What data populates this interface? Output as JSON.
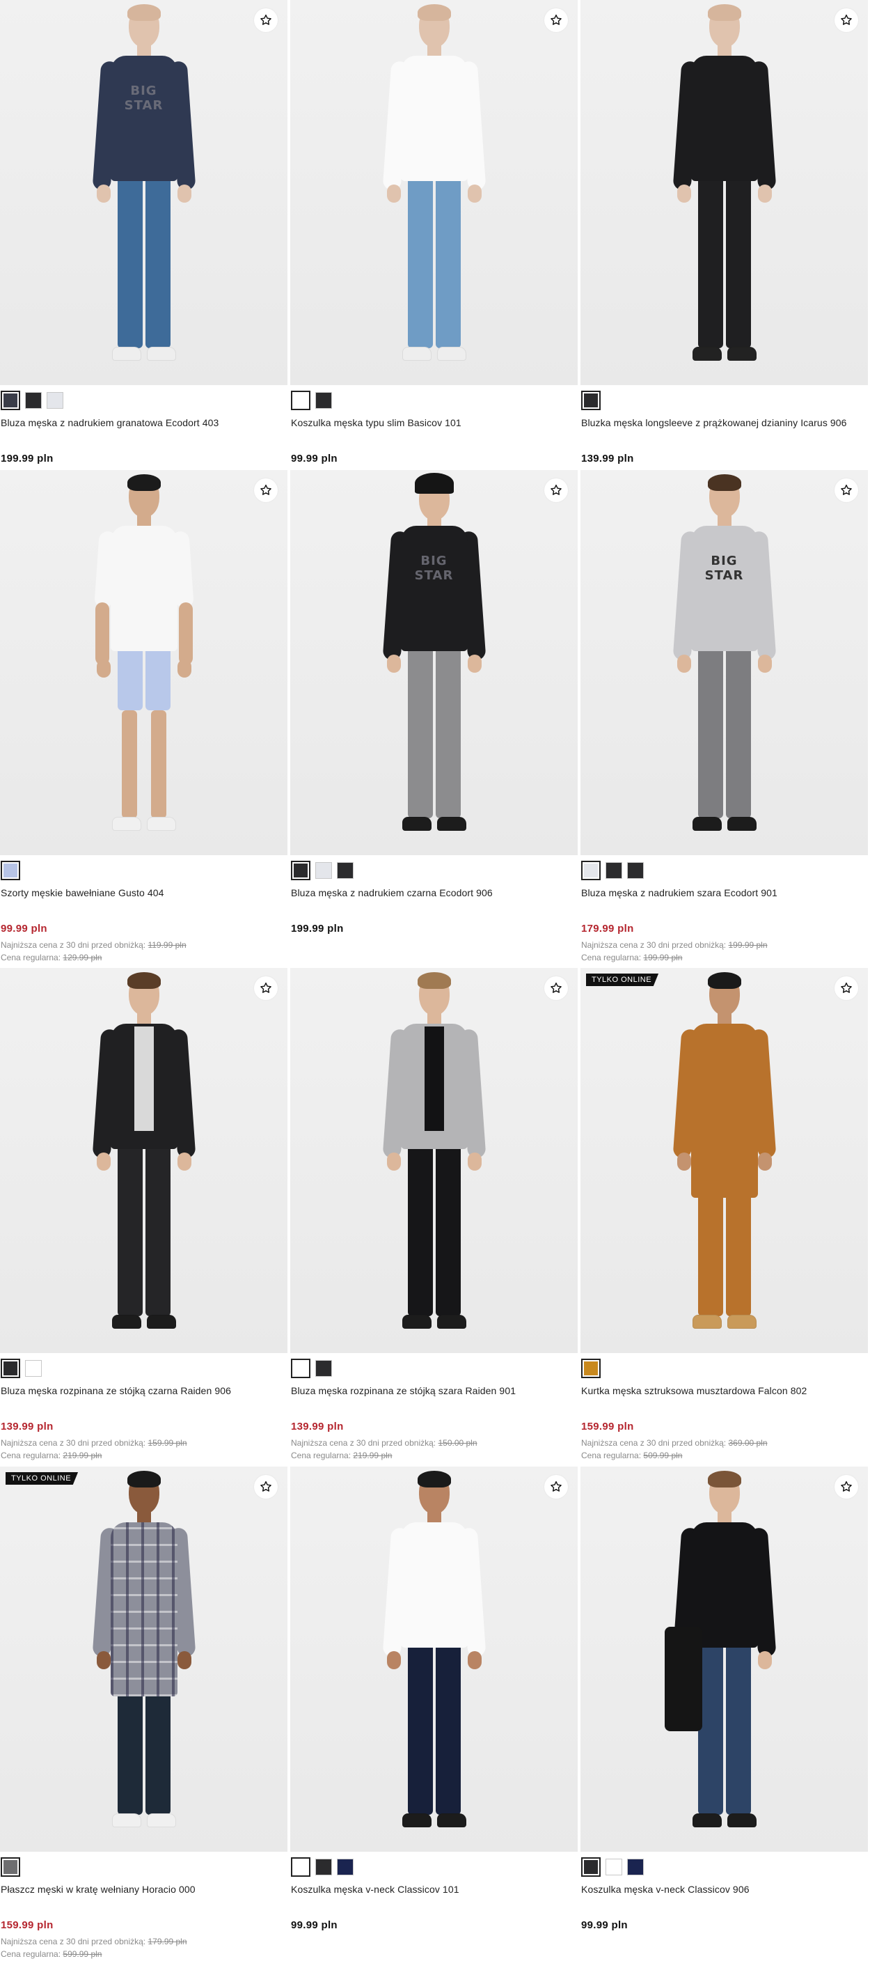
{
  "labels": {
    "lowest_prefix": "Najniższa cena z 30 dni przed obniżką:",
    "regular_prefix": "Cena regularna:"
  },
  "colors": {
    "sale_price": "#b5262f",
    "text": "#111111",
    "muted": "#8a8a8a"
  },
  "products": [
    {
      "name": "Bluza męska z nadrukiem granatowa Ecodort 403",
      "price": "199.99 pln",
      "sale": false,
      "swatches": [
        "#3a3d48",
        "#2b2b2d",
        "#e4e6eb"
      ],
      "badge": "",
      "outfit": {
        "top": "#2f3952",
        "topPrint": "BIG STAR",
        "bottom": "#3e6b99",
        "shoes": "#eeeeee",
        "skin": "#e0c3ae",
        "hair": "#d6b59c"
      }
    },
    {
      "name": "Koszulka męska typu slim Basicov 101",
      "price": "99.99 pln",
      "sale": false,
      "swatches": [
        "#ffffff",
        "#2b2b2d"
      ],
      "badge": "",
      "outfit": {
        "top": "#fafafa",
        "topPrint": "",
        "bottom": "#6f9cc5",
        "shoes": "#eeeeee",
        "skin": "#e0c3ae",
        "hair": "#d6b59c"
      }
    },
    {
      "name": "Bluzka męska longsleeve z prążkowanej dzianiny Icarus 906",
      "price": "139.99 pln",
      "sale": false,
      "swatches": [
        "#2b2b2d"
      ],
      "badge": "",
      "outfit": {
        "top": "#1c1c1e",
        "topPrint": "",
        "bottom": "#1f1f21",
        "shoes": "#222222",
        "skin": "#e0c3ae",
        "hair": "#d6b59c"
      }
    },
    {
      "name": "Szorty męskie bawełniane Gusto 404",
      "price": "99.99 pln",
      "sale": true,
      "lowest": "119.99 pln",
      "regular": "129.99 pln",
      "swatches": [
        "#b7c4e6"
      ],
      "badge": "",
      "outfit": {
        "top": "#f7f7f7",
        "topPrint": "",
        "bottom": "#b8c8ea",
        "shoes": "#f0f0f0",
        "skin": "#d3ab8c",
        "hair": "#1b1b1b",
        "shorts": true
      }
    },
    {
      "name": "Bluza męska z nadrukiem czarna Ecodort 906",
      "price": "199.99 pln",
      "sale": false,
      "swatches": [
        "#2b2b2d",
        "#e4e6eb",
        "#2b2b2d"
      ],
      "badge": "",
      "outfit": {
        "top": "#1d1d1f",
        "topPrint": "BIG STAR",
        "bottom": "#8c8c8e",
        "shoes": "#1c1c1c",
        "skin": "#dcb79b",
        "hair": "#1a1a1a",
        "cap": true
      }
    },
    {
      "name": "Bluza męska z nadrukiem szara Ecodort 901",
      "price": "179.99 pln",
      "sale": true,
      "lowest": "199.99 pln",
      "regular": "199.99 pln",
      "swatches": [
        "#e4e6eb",
        "#2b2b2d",
        "#2b2b2d"
      ],
      "badge": "",
      "outfit": {
        "top": "#c8c8cb",
        "topPrint": "BIG STAR",
        "bottom": "#7d7d80",
        "shoes": "#1c1c1c",
        "skin": "#dcb79b",
        "hair": "#4a3322"
      }
    },
    {
      "name": "Bluza męska rozpinana ze stójką czarna Raiden 906",
      "price": "139.99 pln",
      "sale": true,
      "lowest": "159.99 pln",
      "regular": "219.99 pln",
      "swatches": [
        "#2b2b2d",
        "#ffffff"
      ],
      "badge": "",
      "outfit": {
        "top": "#202022",
        "topPrint": "",
        "bottom": "#252527",
        "shoes": "#1c1c1c",
        "skin": "#dcb79b",
        "hair": "#5a3d27",
        "inner": "#d9d9d9"
      }
    },
    {
      "name": "Bluza męska rozpinana ze stójką szara Raiden 901",
      "price": "139.99 pln",
      "sale": true,
      "lowest": "150.00 pln",
      "regular": "219.99 pln",
      "swatches": [
        "#ffffff",
        "#2b2b2d"
      ],
      "badge": "",
      "outfit": {
        "top": "#b4b4b6",
        "topPrint": "",
        "bottom": "#161618",
        "shoes": "#1c1c1c",
        "skin": "#dcb79b",
        "hair": "#a07a52",
        "inner": "#121214"
      }
    },
    {
      "name": "Kurtka męska sztruksowa musztardowa Falcon 802",
      "price": "159.99 pln",
      "sale": true,
      "lowest": "369.00 pln",
      "regular": "509.99 pln",
      "swatches": [
        "#c8891f"
      ],
      "badge": "TYLKO ONLINE",
      "outfit": {
        "top": "#b8722c",
        "topPrint": "",
        "bottom": "#b8722c",
        "shoes": "#c99a5a",
        "skin": "#c4936f",
        "hair": "#1a1a1a",
        "coat": true
      }
    },
    {
      "name": "Płaszcz męski w kratę wełniany Horacio 000",
      "price": "159.99 pln",
      "sale": true,
      "lowest": "179.99 pln",
      "regular": "599.99 pln",
      "swatches": [
        "#6e6e70"
      ],
      "badge": "TYLKO ONLINE",
      "outfit": {
        "top": "#8d8f9b",
        "topPrint": "",
        "bottom": "#1e2a38",
        "shoes": "#f0f0f0",
        "skin": "#8a5a3c",
        "hair": "#1a1a1a",
        "coat": true,
        "plaid": true
      }
    },
    {
      "name": "Koszulka męska v-neck Classicov 101",
      "price": "99.99 pln",
      "sale": false,
      "swatches": [
        "#ffffff",
        "#2b2b2d",
        "#1a2450"
      ],
      "badge": "",
      "outfit": {
        "top": "#fafafa",
        "topPrint": "",
        "bottom": "#17203a",
        "shoes": "#1c1c1c",
        "skin": "#b98463",
        "hair": "#1a1a1a"
      }
    },
    {
      "name": "Koszulka męska v-neck Classicov 906",
      "price": "99.99 pln",
      "sale": false,
      "swatches": [
        "#2b2b2d",
        "#ffffff",
        "#1a2450"
      ],
      "badge": "",
      "outfit": {
        "top": "#141416",
        "topPrint": "",
        "bottom": "#2d4466",
        "shoes": "#1c1c1c",
        "skin": "#dcb79b",
        "hair": "#7a5538",
        "jacket": true
      }
    }
  ]
}
